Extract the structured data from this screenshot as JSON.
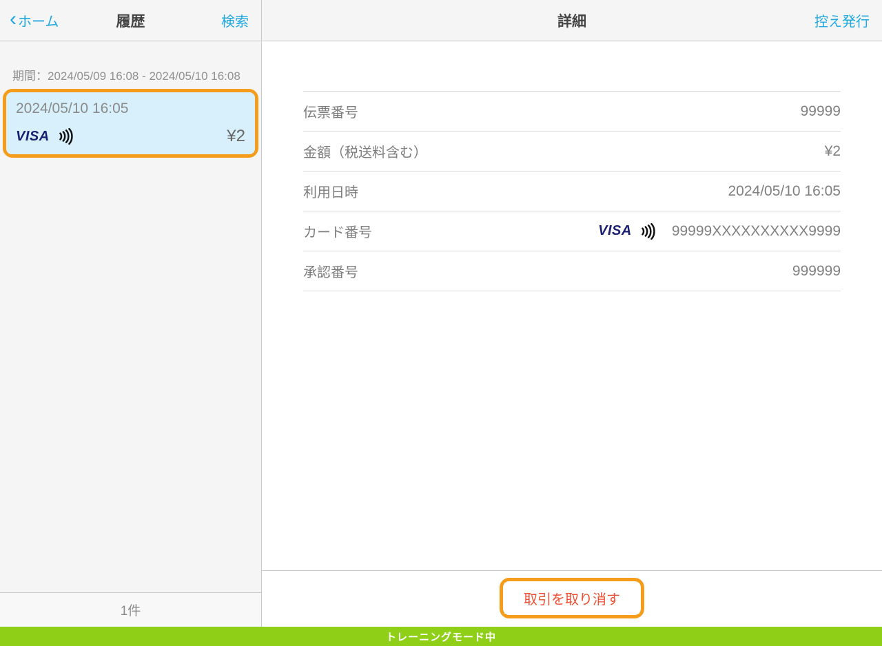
{
  "left": {
    "back_label": "ホーム",
    "title": "履歴",
    "search_label": "検索",
    "period_label": "期間：2024/05/09 16:08 - 2024/05/10 16:08",
    "footer_count": "1件"
  },
  "transaction": {
    "datetime": "2024/05/10 16:05",
    "brand": "VISA",
    "amount": "¥2"
  },
  "right": {
    "title": "詳細",
    "receipt_label": "控え発行",
    "cancel_label": "取引を取り消す"
  },
  "detail": {
    "rows": [
      {
        "label": "伝票番号",
        "value": "99999"
      },
      {
        "label": "金額（税送料含む）",
        "value": "¥2"
      },
      {
        "label": "利用日時",
        "value": "2024/05/10 16:05"
      },
      {
        "label": "カード番号",
        "value": "99999XXXXXXXXXX9999",
        "card": true,
        "brand": "VISA"
      },
      {
        "label": "承認番号",
        "value": "999999"
      }
    ]
  },
  "banner": {
    "text": "トレーニングモード中"
  }
}
